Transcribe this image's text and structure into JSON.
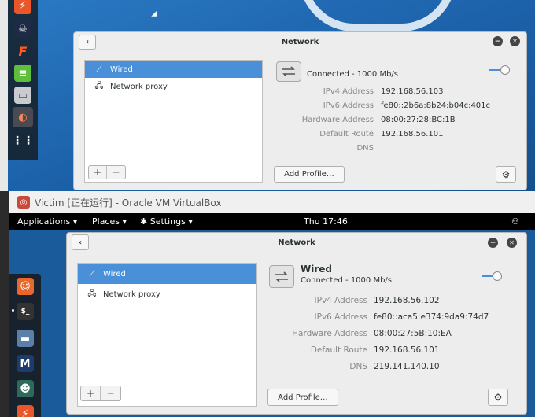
{
  "colors": {
    "accent": "#4a90d9",
    "desktop": "#1d5d9e",
    "panel": "#000000"
  },
  "top_window": {
    "title": "Network",
    "sidebar": [
      {
        "icon": "wired-icon",
        "label": "Wired",
        "selected": true
      },
      {
        "icon": "proxy-icon",
        "label": "Network proxy",
        "selected": false
      }
    ],
    "add_label": "+",
    "remove_label": "−",
    "status": "Connected - 1000 Mb/s",
    "rows": [
      {
        "label": "IPv4 Address",
        "value": "192.168.56.103"
      },
      {
        "label": "IPv6 Address",
        "value": "fe80::2b6a:8b24:b04c:401c"
      },
      {
        "label": "Hardware Address",
        "value": "08:00:27:28:BC:1B"
      },
      {
        "label": "Default Route",
        "value": "192.168.56.101"
      },
      {
        "label": "DNS",
        "value": ""
      }
    ],
    "add_profile": "Add Profile…",
    "gear": "⚙"
  },
  "virtualbox": {
    "title": "Victim [正在运行] - Oracle VM VirtualBox"
  },
  "gnome_panel": {
    "applications": "Applications",
    "places": "Places",
    "settings": "Settings",
    "clock": "Thu 17:46"
  },
  "bottom_window": {
    "title": "Network",
    "sidebar": [
      {
        "icon": "wired-icon",
        "label": "Wired",
        "selected": true
      },
      {
        "icon": "proxy-icon",
        "label": "Network proxy",
        "selected": false
      }
    ],
    "add_label": "+",
    "remove_label": "−",
    "heading": "Wired",
    "status": "Connected - 1000 Mb/s",
    "rows": [
      {
        "label": "IPv4 Address",
        "value": "192.168.56.102"
      },
      {
        "label": "IPv6 Address",
        "value": "fe80::aca5:e374:9da9:74d7"
      },
      {
        "label": "Hardware Address",
        "value": "08:00:27:5B:10:EA"
      },
      {
        "label": "Default Route",
        "value": "192.168.56.101"
      },
      {
        "label": "DNS",
        "value": "219.141.140.10"
      }
    ],
    "add_profile": "Add Profile…",
    "gear": "⚙"
  }
}
